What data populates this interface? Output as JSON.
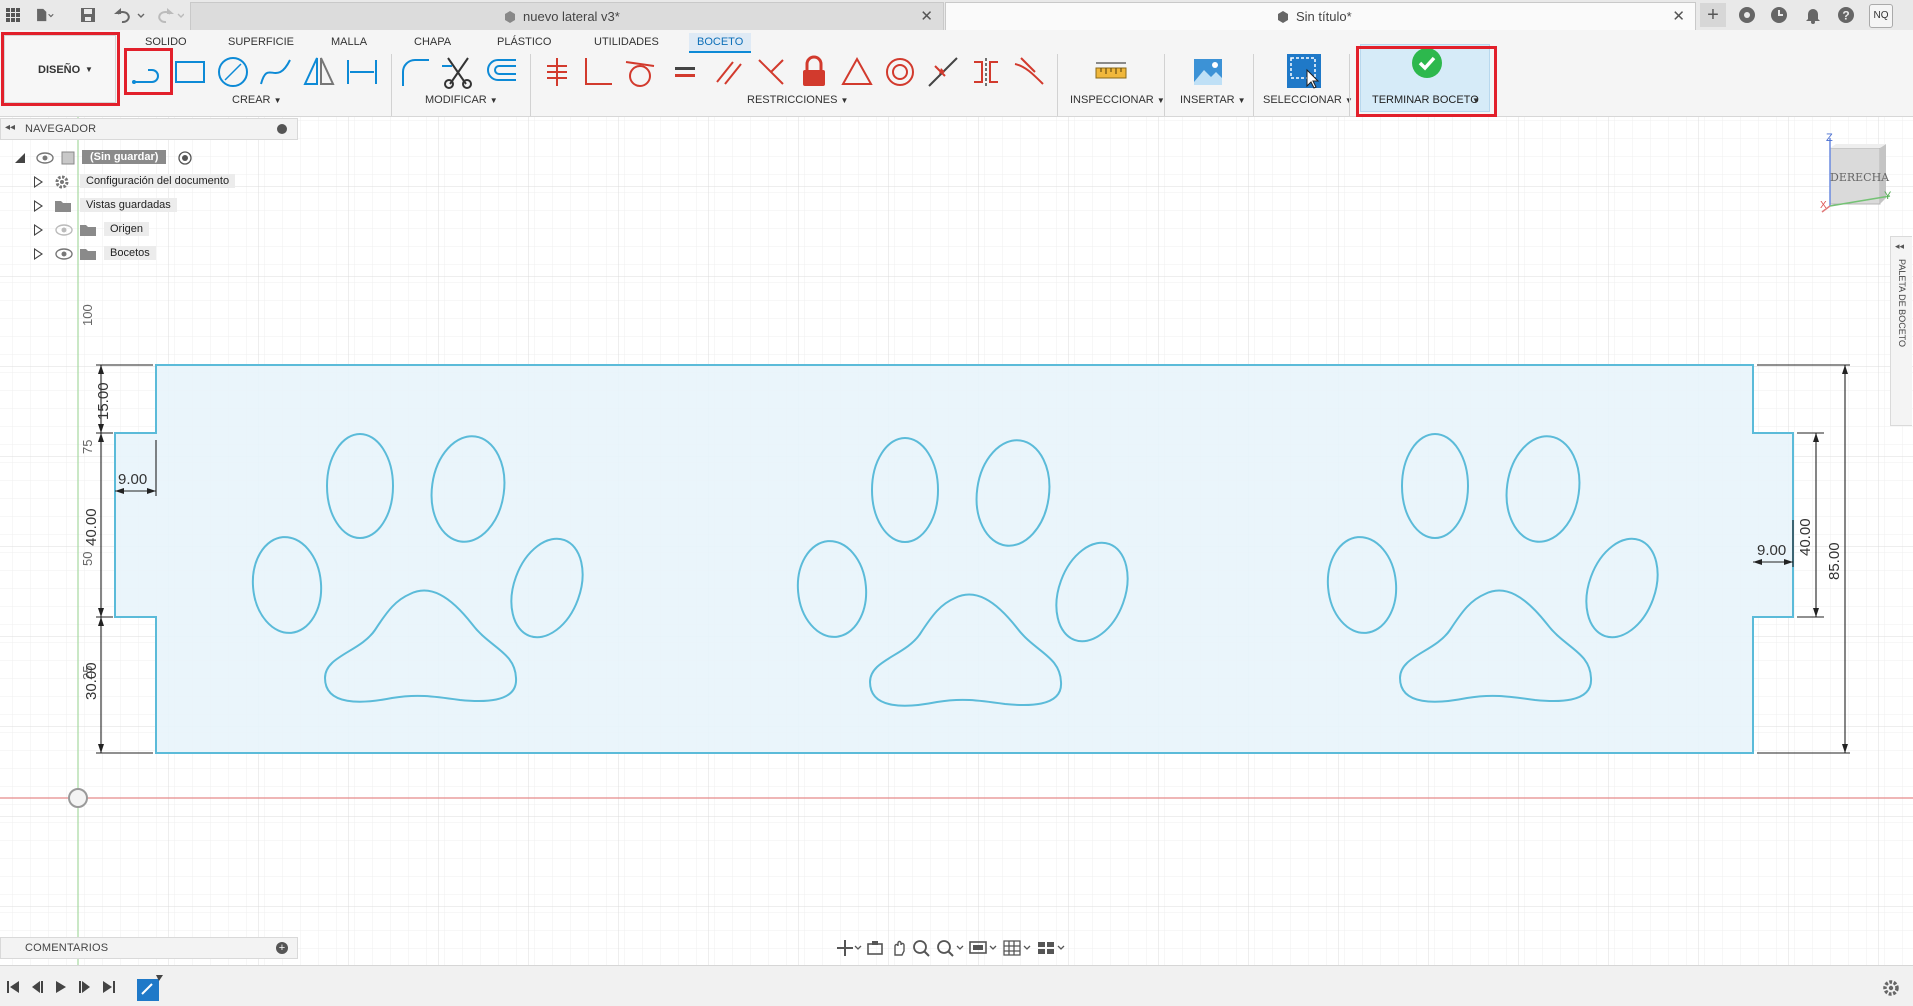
{
  "titlebar": {
    "tabs": [
      {
        "name": "nuevo lateral v3*",
        "active": false
      },
      {
        "name": "Sin título*",
        "active": true
      }
    ],
    "user_initials": "NQ"
  },
  "ribbon": {
    "workspace": "DISEÑO",
    "tabs": [
      "SOLIDO",
      "SUPERFICIE",
      "MALLA",
      "CHAPA",
      "PLÁSTICO",
      "UTILIDADES",
      "BOCETO"
    ],
    "active_tab": "BOCETO",
    "groups": [
      "CREAR",
      "MODIFICAR",
      "RESTRICCIONES",
      "INSPECCIONAR",
      "INSERTAR",
      "SELECCIONAR",
      "TERMINAR BOCETO"
    ]
  },
  "navigator": {
    "title": "NAVEGADOR",
    "root": "(Sin guardar)",
    "items": [
      "Configuración del documento",
      "Vistas guardadas",
      "Origen",
      "Bocetos"
    ]
  },
  "comments": {
    "title": "COMENTARIOS"
  },
  "viewcube": {
    "face": "DERECHA",
    "axes": {
      "z": "Z",
      "y": "Y",
      "x": "X"
    }
  },
  "palette": {
    "label": "PALETA DE BOCETO"
  },
  "axis_labels": {
    "v100": "100",
    "v75": "75",
    "v50": "50",
    "v25": "25"
  },
  "dimensions": {
    "top_notch_height": "15.00",
    "left_notch_width": "9.00",
    "left_tab_height": "40.00",
    "bottom_height": "30.00",
    "right_notch_width": "9.00",
    "right_tab_height": "40.00",
    "total_height": "85.00"
  },
  "colors": {
    "accent": "#0d8ad6",
    "highlight": "#e2202b",
    "sketch_line": "#5bbbd9",
    "profile_fill": "#e6f3fb",
    "finish_green": "#2db84d"
  }
}
